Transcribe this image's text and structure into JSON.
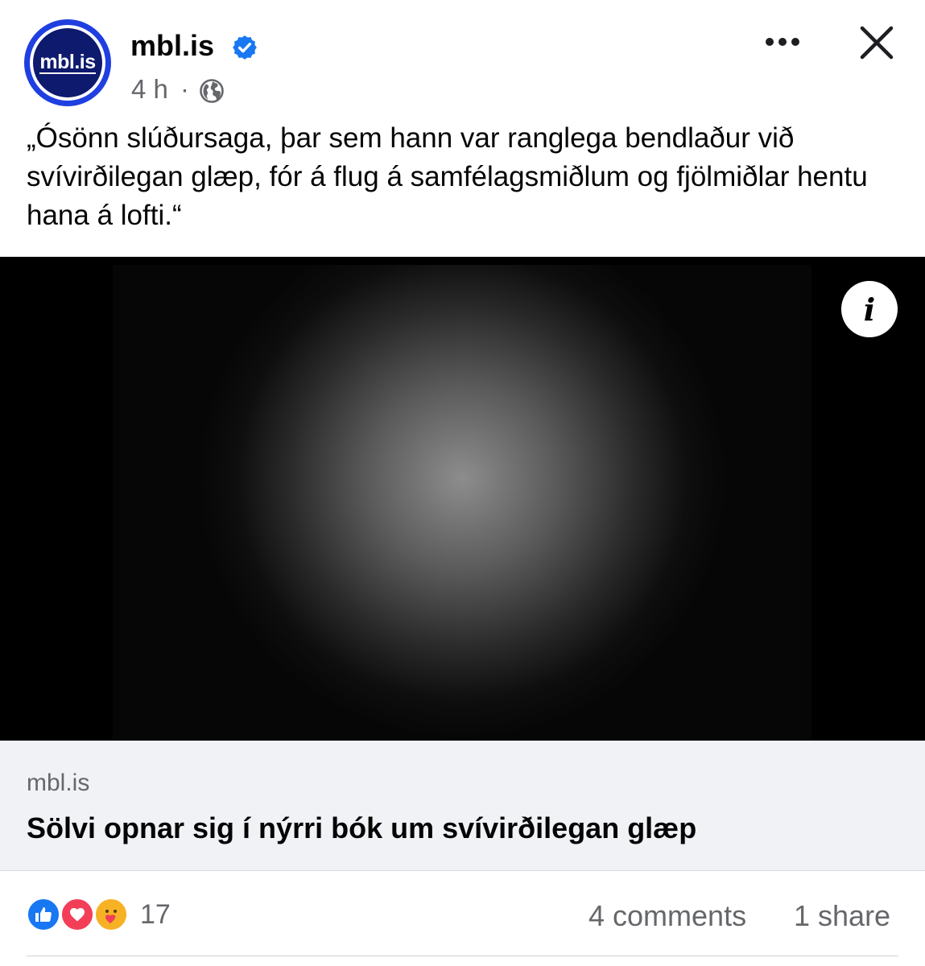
{
  "post": {
    "page_name": "mbl.is",
    "avatar_text": "mbl.is",
    "time": "4 h",
    "separator": "·",
    "audience_icon": "globe-icon",
    "verified_icon": "verified-badge-icon",
    "text": "„Ósönn slúðursaga, þar sem hann var ranglega bendlaður við svívirðilegan glæp, fór á flug á samfélagsmiðlum og fjölmiðlar hentu hana á lofti.“"
  },
  "header_actions": {
    "more_icon": "more-dots-icon",
    "close_icon": "close-icon"
  },
  "media": {
    "info_label": "i"
  },
  "link_preview": {
    "domain": "mbl.is",
    "title": "Sölvi opnar sig í nýrri bók um svívirðilegan glæp"
  },
  "engagement": {
    "reaction_icons": [
      "like-icon",
      "love-icon",
      "care-icon"
    ],
    "reaction_count": "17",
    "comments": "4 comments",
    "shares": "1 share"
  },
  "colors": {
    "brand_blue": "#1f3fe0",
    "avatar_navy": "#0d1a6e",
    "verified_blue": "#1877f2",
    "secondary_text": "#65676b",
    "card_bg": "#f0f2f5"
  }
}
